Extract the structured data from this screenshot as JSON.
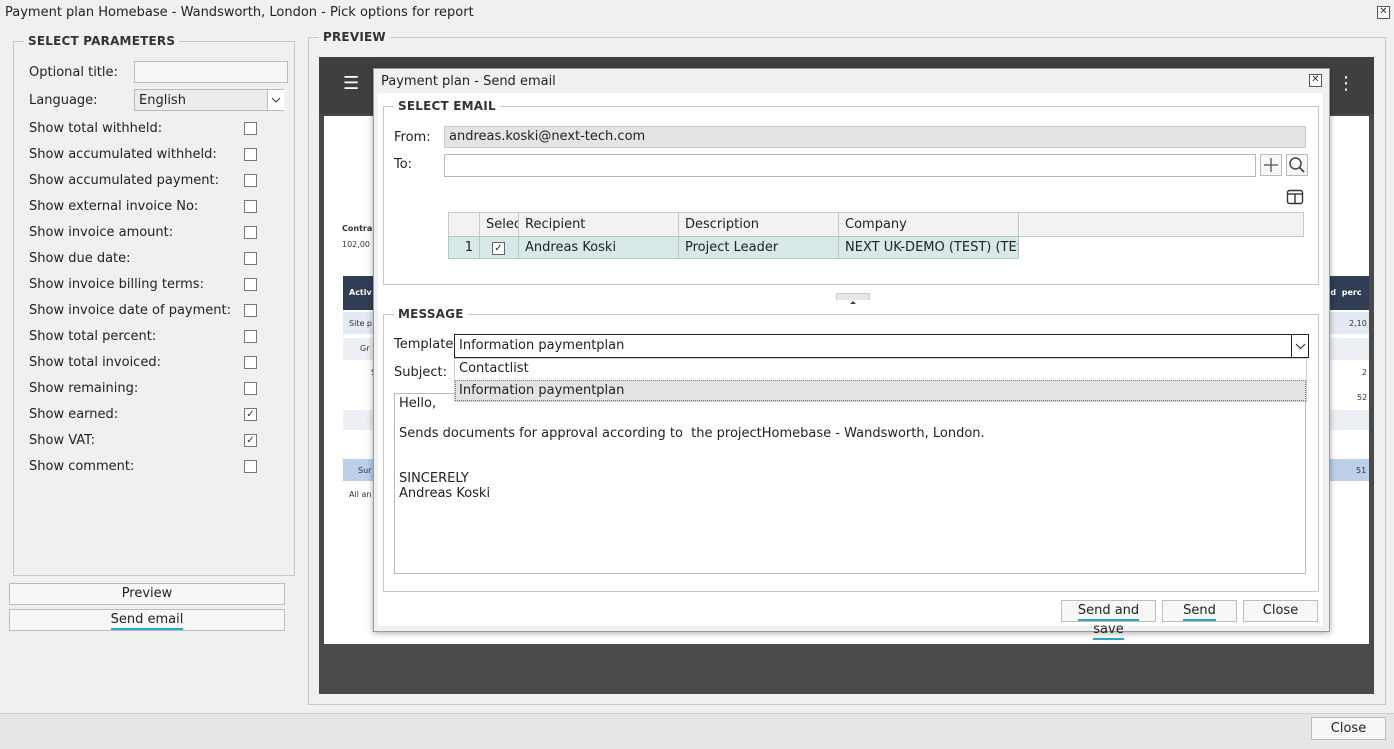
{
  "window": {
    "title": "Payment plan Homebase - Wandsworth, London - Pick options for report",
    "close_glyph": "✕"
  },
  "parameters": {
    "legend": "SELECT PARAMETERS",
    "optional_title_label": "Optional title:",
    "optional_title_value": "",
    "language_label": "Language:",
    "language_value": "English",
    "options": [
      {
        "label": "Show total withheld:",
        "checked": false
      },
      {
        "label": "Show accumulated withheld:",
        "checked": false
      },
      {
        "label": "Show accumulated payment:",
        "checked": false
      },
      {
        "label": "Show external invoice No:",
        "checked": false
      },
      {
        "label": "Show invoice amount:",
        "checked": false
      },
      {
        "label": "Show due date:",
        "checked": false
      },
      {
        "label": "Show invoice billing terms:",
        "checked": false
      },
      {
        "label": "Show invoice date of payment:",
        "checked": false
      },
      {
        "label": "Show total percent:",
        "checked": false
      },
      {
        "label": "Show total invoiced:",
        "checked": false
      },
      {
        "label": "Show remaining:",
        "checked": false
      },
      {
        "label": "Show earned:",
        "checked": true
      },
      {
        "label": "Show VAT:",
        "checked": true
      },
      {
        "label": "Show comment:",
        "checked": false
      }
    ],
    "check_glyph": "✓",
    "preview_button": "Preview",
    "send_email_button": "Send email"
  },
  "preview": {
    "legend": "PREVIEW",
    "menu_glyph": "☰",
    "more_glyph": "⋮",
    "report_fragments": {
      "contract_label": "Contra",
      "contract_value": "102,00",
      "header_left": "Activ",
      "header_right": "ed  perc",
      "row1_left": "Site p",
      "row1_right": "2,10",
      "row2_left": "Gr",
      "row3_left": "S",
      "row3_right": "2",
      "row4_right": "52",
      "sum_left": "Sur",
      "sum_right": "51",
      "footer_left": "All an"
    }
  },
  "dialog": {
    "title": "Payment plan - Send email",
    "select_email_legend": "SELECT EMAIL",
    "from_label": "From:",
    "from_value": "andreas.koski@next-tech.com",
    "to_label": "To:",
    "to_value": "",
    "recipients_table": {
      "columns": [
        "",
        "Selec",
        "Recipient",
        "Description",
        "Company"
      ],
      "rows": [
        {
          "index": "1",
          "selected": true,
          "recipient": "Andreas Koski",
          "description": "Project Leader",
          "company": "NEXT UK-DEMO (TEST) (TES..."
        }
      ]
    },
    "message_legend": "MESSAGE",
    "template_label": "Template:",
    "template_value": "Information paymentplan",
    "template_options": [
      "Contactlist",
      "Information paymentplan"
    ],
    "subject_label": "Subject:",
    "body_lines": [
      "Hello,",
      "",
      "Sends documents for approval according to  the projectHomebase - Wandsworth, London.",
      "",
      "",
      "SINCERELY",
      "Andreas Koski"
    ],
    "send_and_save_button": "Send and save",
    "send_button": "Send",
    "close_button": "Close"
  },
  "footer": {
    "close_button": "Close"
  },
  "colors": {
    "accent_underline": "#2aa6c6",
    "report_header": "#2f3e55",
    "highlight_row": "#d9e8e8"
  }
}
